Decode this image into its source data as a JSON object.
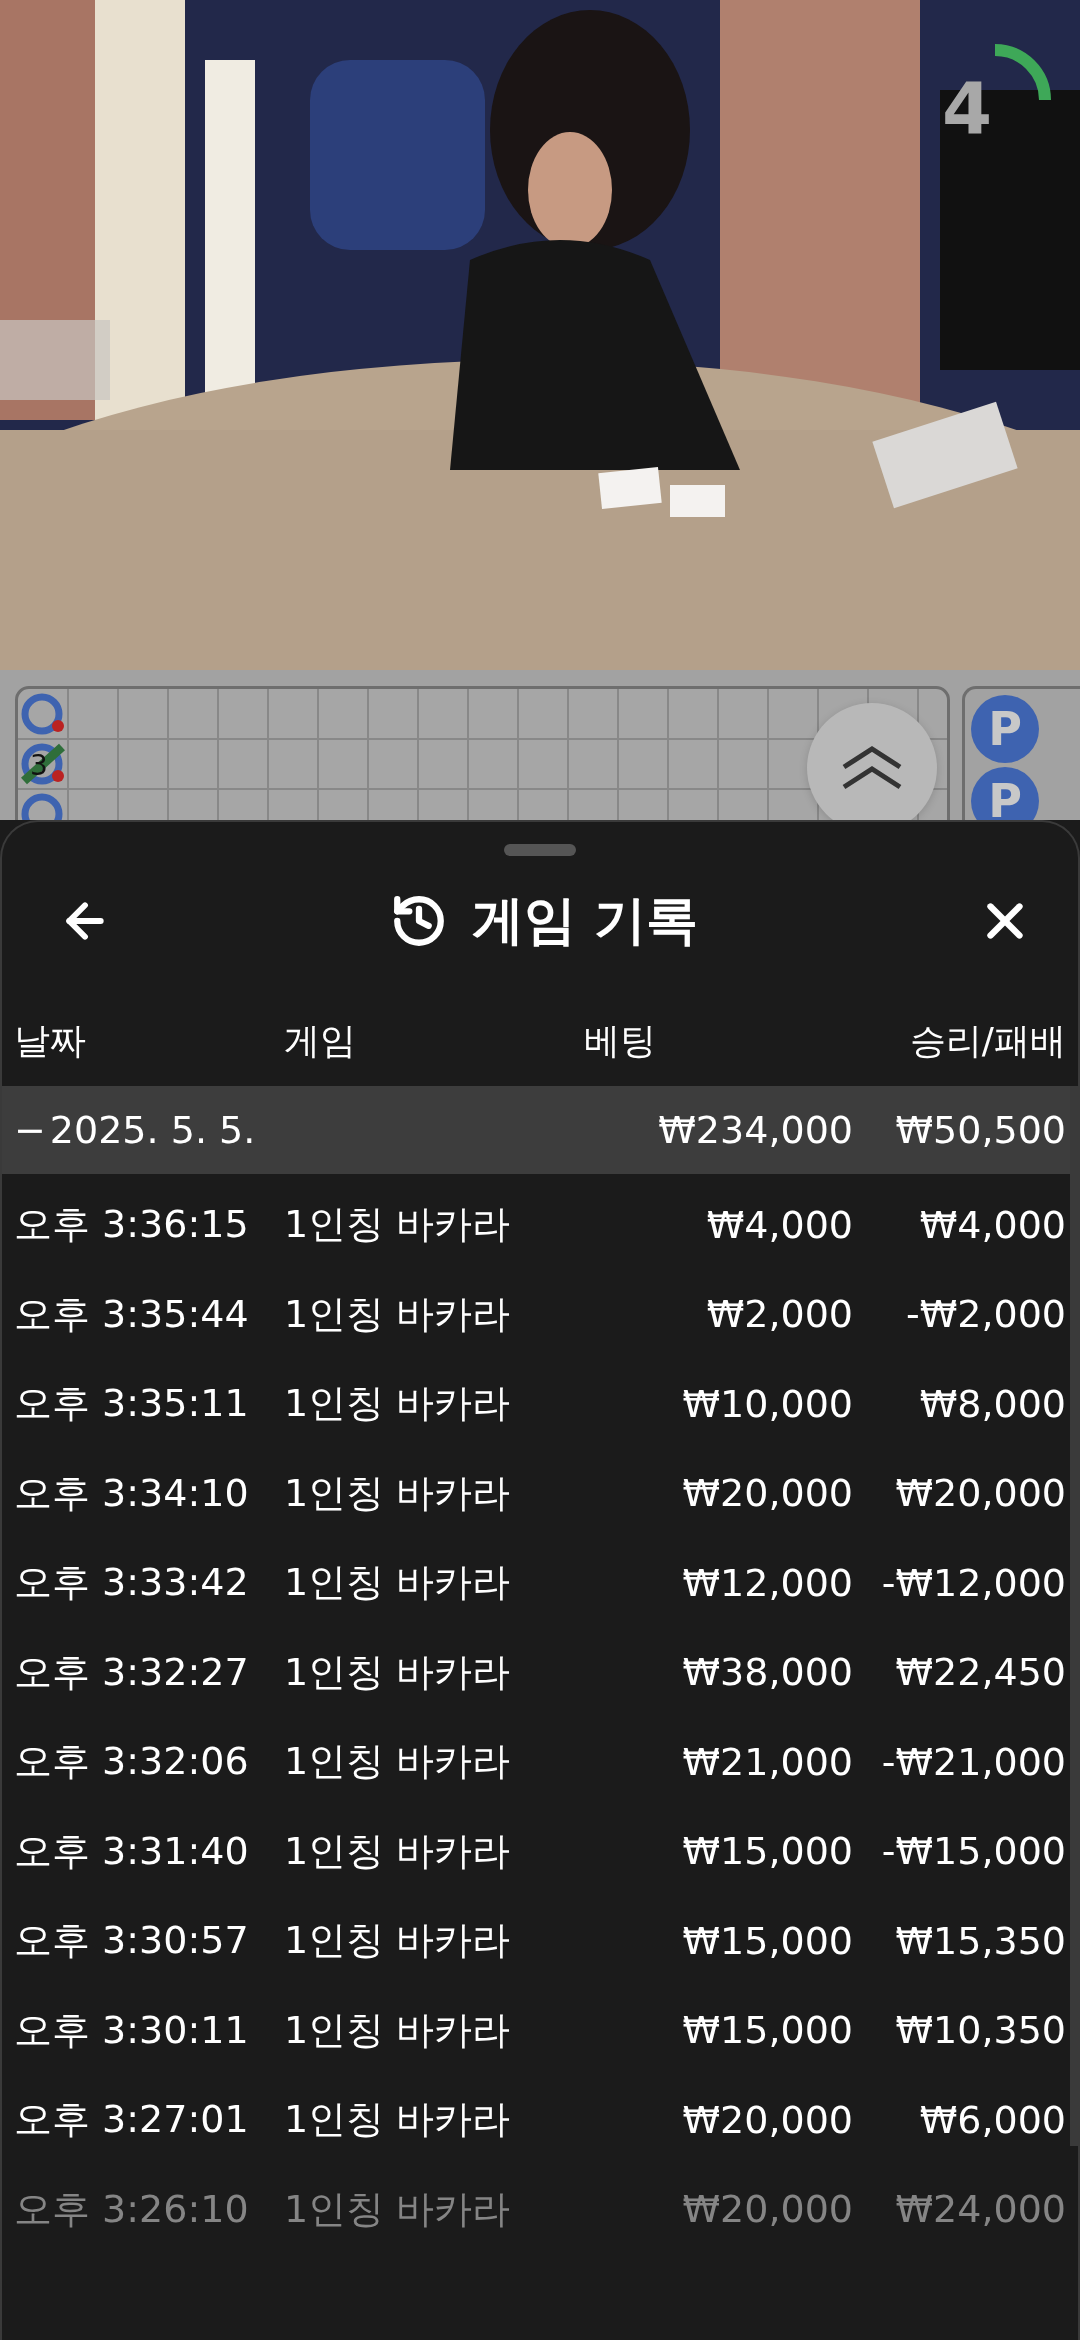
{
  "video": {
    "countdown": {
      "value": "4"
    }
  },
  "roadmap": {
    "marker_label": "3",
    "side_marks": [
      "P",
      "P"
    ]
  },
  "sheet": {
    "title": "게임 기록",
    "columns": [
      "날짜",
      "게임",
      "베팅",
      "승리/패배"
    ],
    "group": {
      "toggle": "−",
      "date": "2025. 5. 5.",
      "bet": "₩234,000",
      "result": "₩50,500"
    },
    "rows": [
      {
        "time": "오후 3:36:15",
        "game": "1인칭 바카라",
        "bet": "₩4,000",
        "result": "₩4,000"
      },
      {
        "time": "오후 3:35:44",
        "game": "1인칭 바카라",
        "bet": "₩2,000",
        "result": "-₩2,000"
      },
      {
        "time": "오후 3:35:11",
        "game": "1인칭 바카라",
        "bet": "₩10,000",
        "result": "₩8,000"
      },
      {
        "time": "오후 3:34:10",
        "game": "1인칭 바카라",
        "bet": "₩20,000",
        "result": "₩20,000"
      },
      {
        "time": "오후 3:33:42",
        "game": "1인칭 바카라",
        "bet": "₩12,000",
        "result": "-₩12,000"
      },
      {
        "time": "오후 3:32:27",
        "game": "1인칭 바카라",
        "bet": "₩38,000",
        "result": "₩22,450"
      },
      {
        "time": "오후 3:32:06",
        "game": "1인칭 바카라",
        "bet": "₩21,000",
        "result": "-₩21,000"
      },
      {
        "time": "오후 3:31:40",
        "game": "1인칭 바카라",
        "bet": "₩15,000",
        "result": "-₩15,000"
      },
      {
        "time": "오후 3:30:57",
        "game": "1인칭 바카라",
        "bet": "₩15,000",
        "result": "₩15,350"
      },
      {
        "time": "오후 3:30:11",
        "game": "1인칭 바카라",
        "bet": "₩15,000",
        "result": "₩10,350"
      },
      {
        "time": "오후 3:27:01",
        "game": "1인칭 바카라",
        "bet": "₩20,000",
        "result": "₩6,000"
      },
      {
        "time": "오후 3:26:10",
        "game": "1인칭 바카라",
        "bet": "₩20,000",
        "result": "₩24,000"
      }
    ]
  }
}
